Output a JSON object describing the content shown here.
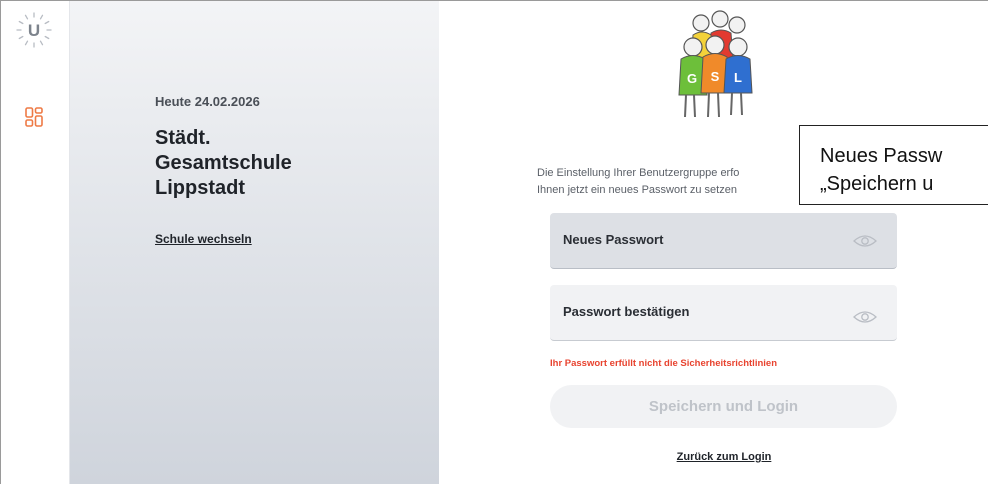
{
  "app": {
    "logo_letter": "U",
    "logo_icon": "sun-u-logo-icon",
    "nav_icon": "dashboard-grid-icon",
    "accent_color": "#ee7a45"
  },
  "school_panel": {
    "date_label": "Heute 24.02.2026",
    "school_name": "Städt.\nGesamtschule\nLippstadt",
    "switch_school_link": "Schule wechseln"
  },
  "school_logo": {
    "icon": "gsl-school-logo",
    "letters": [
      "G",
      "S",
      "L"
    ]
  },
  "form": {
    "info_text": "Die Einstellung Ihrer Benutzergruppe erfo\nIhnen jetzt ein neues Passwort zu setzen",
    "new_password_label": "Neues Passwort",
    "confirm_password_label": "Passwort bestätigen",
    "eye_icon": "eye-icon",
    "error_message": "Ihr Passwort erfüllt nicht die Sicherheitsrichtlinien",
    "error_color": "#e8432f",
    "save_button": "Speichern und Login",
    "back_link": "Zurück zum Login"
  },
  "overlay_hint": {
    "text": "Neues Passw\n„Speichern u"
  }
}
